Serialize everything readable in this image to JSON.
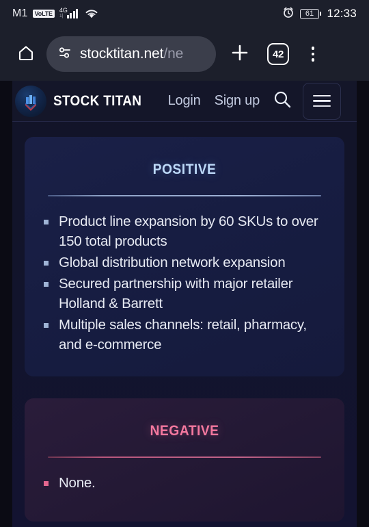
{
  "status_bar": {
    "carrier": "M1",
    "volte_badge": "VoLTE",
    "network_type": "4G",
    "network_sub": "1|",
    "battery_percent": "61",
    "time": "12:33",
    "icons": {
      "alarm": "alarm-clock-icon",
      "wifi": "wifi-icon",
      "signal": "signal-bars-icon",
      "battery": "battery-icon"
    }
  },
  "browser": {
    "home_icon": "home-icon",
    "page_info_icon": "page-settings-tune-icon",
    "url": "stocktitan.net",
    "url_dim": "/ne",
    "new_tab_icon": "plus-icon",
    "tab_count": "42",
    "menu_icon": "three-dot-menu-icon"
  },
  "site_header": {
    "brand": "STOCK TITAN",
    "logo_icon": "stock-titan-logo-icon",
    "login": "Login",
    "signup": "Sign up",
    "search_icon": "search-icon",
    "hamburger_icon": "hamburger-menu-icon"
  },
  "cards": {
    "positive": {
      "title": "Positive",
      "accent_color": "#bcd8f7",
      "points": [
        "Product line expansion by 60 SKUs to over 150 total products",
        "Global distribution network expansion",
        "Secured partnership with major retailer Holland & Barrett",
        "Multiple sales channels: retail, pharmacy, and e-commerce"
      ]
    },
    "negative": {
      "title": "Negative",
      "accent_color": "#f4789f",
      "points": [
        "None."
      ]
    }
  }
}
